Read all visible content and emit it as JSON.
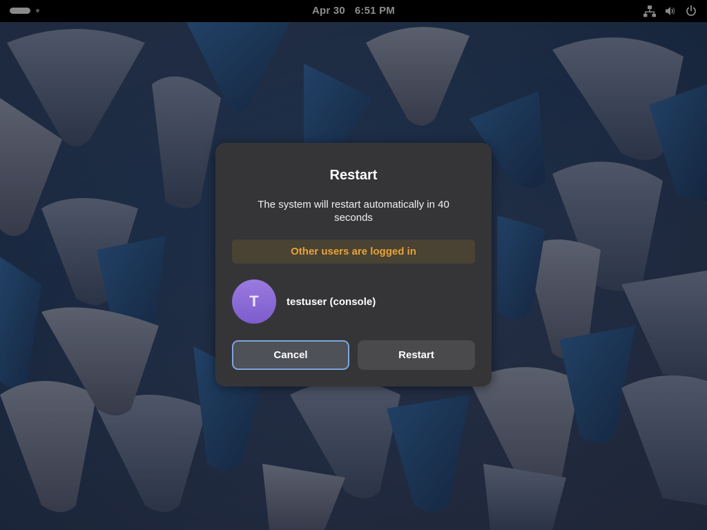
{
  "topbar": {
    "date": "Apr 30",
    "time": "6:51 PM",
    "icons": [
      "workspace-indicator-icon",
      "network-wired-icon",
      "volume-icon",
      "power-icon"
    ]
  },
  "dialog": {
    "title": "Restart",
    "message": "The system will restart automatically in 40 seconds",
    "warning": "Other users are logged in",
    "warning_color": "#e6a33a",
    "user": {
      "avatar_initial": "T",
      "name": "testuser (console)"
    },
    "buttons": {
      "cancel_label": "Cancel",
      "restart_label": "Restart"
    }
  },
  "colors": {
    "dialog_bg": "#353538",
    "focus_ring": "#7fa6e0",
    "avatar": "#8a6ad6"
  }
}
